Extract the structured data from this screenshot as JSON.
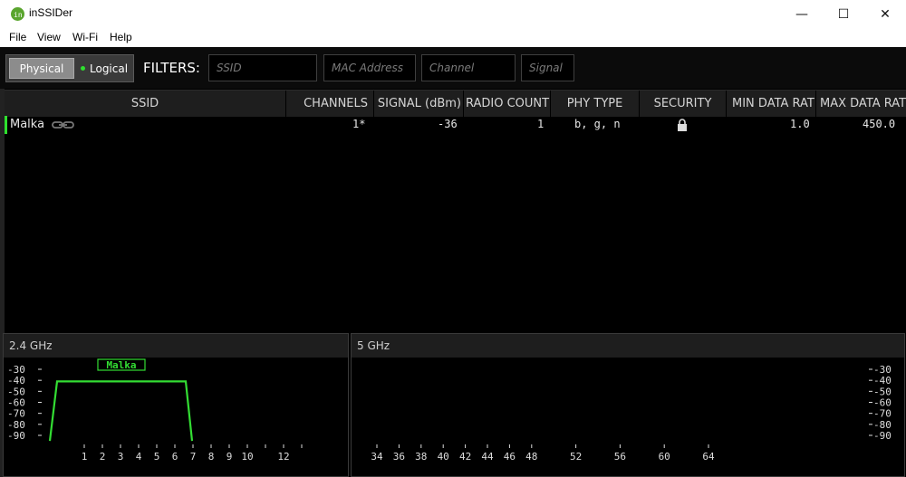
{
  "window": {
    "title": "inSSIDer",
    "minimize": "—",
    "maximize": "☐",
    "close": "✕"
  },
  "menu": [
    "File",
    "View",
    "Wi-Fi",
    "Help"
  ],
  "toolbar": {
    "physical_label": "Physical",
    "logical_label": "Logical",
    "filters_label": "FILTERS:",
    "filter_placeholders": [
      "SSID",
      "MAC Address",
      "Channel",
      "Signal"
    ]
  },
  "columns": [
    "SSID",
    "CHANNELS",
    "SIGNAL (dBm)",
    "RADIO COUNT",
    "PHY TYPE",
    "SECURITY",
    "MIN DATA RATE",
    "MAX DATA RATE"
  ],
  "rows": [
    {
      "ssid": "Malka",
      "channels": "1*",
      "signal": "-36",
      "radio_count": "1",
      "phy_type": "b, g, n",
      "security": "lock-icon",
      "min_rate": "1.0",
      "max_rate": "450.0"
    }
  ],
  "panels": {
    "band_24": "2.4 GHz",
    "band_5": "5 GHz"
  },
  "colors": {
    "accent_green": "#2ee02e",
    "trace_green": "#33dd33"
  },
  "chart_data": [
    {
      "type": "area",
      "title": "2.4 GHz",
      "y_ticks": [
        "-30",
        "-40",
        "-50",
        "-60",
        "-70",
        "-80",
        "-90"
      ],
      "x_ticks": [
        "1",
        "2",
        "3",
        "4",
        "5",
        "6",
        "7",
        "8",
        "9",
        "10",
        "12"
      ],
      "ylim": [
        -95,
        -30
      ],
      "series": [
        {
          "name": "Malka",
          "channel": 1,
          "signal": -36,
          "x": [
            -1,
            0,
            5,
            6
          ],
          "y": [
            -95,
            -41,
            -41,
            -95
          ]
        }
      ]
    },
    {
      "type": "area",
      "title": "5 GHz",
      "y_ticks": [
        "-30",
        "-40",
        "-50",
        "-60",
        "-70",
        "-80",
        "-90"
      ],
      "x_ticks": [
        "34",
        "36",
        "38",
        "40",
        "42",
        "44",
        "46",
        "48",
        "52",
        "56",
        "60",
        "64"
      ],
      "ylim": [
        -95,
        -30
      ],
      "series": []
    }
  ]
}
